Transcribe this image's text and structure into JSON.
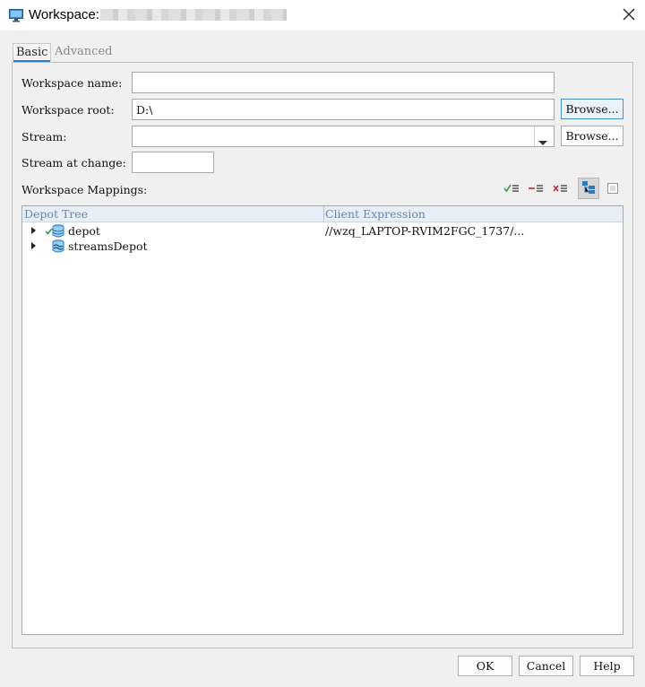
{
  "window": {
    "title": "Workspace:",
    "title_icon": "monitor-icon",
    "close_icon": "close-icon"
  },
  "tabs": [
    {
      "label": "Basic",
      "selected": true
    },
    {
      "label": "Advanced",
      "selected": false
    }
  ],
  "form": {
    "workspace_name": {
      "label": "Workspace name:",
      "value": ""
    },
    "workspace_root": {
      "label": "Workspace root:",
      "value": "D:\\",
      "browse_label": "Browse..."
    },
    "stream": {
      "label": "Stream:",
      "value": "",
      "browse_label": "Browse..."
    },
    "stream_at_change": {
      "label": "Stream at change:",
      "value": ""
    }
  },
  "mappings": {
    "label": "Workspace Mappings:",
    "toolbar": [
      "include-mapping-icon",
      "exclude-mapping-icon",
      "remove-mapping-icon",
      "tree-view-icon",
      "text-view-icon"
    ],
    "columns": [
      "Depot Tree",
      "Client Expression"
    ],
    "rows": [
      {
        "name": "depot",
        "icon": "depot-icon",
        "included": true,
        "expression": "//wzq_LAPTOP-RVIM2FGC_1737/..."
      },
      {
        "name": "streamsDepot",
        "icon": "streams-depot-icon",
        "included": false,
        "expression": ""
      }
    ]
  },
  "footer": {
    "ok": "OK",
    "cancel": "Cancel",
    "help": "Help"
  },
  "colors": {
    "accent": "#2d7fd2",
    "header_bg": "#e7eef6",
    "header_text": "#6a87a8",
    "include_green": "#2a9a3a",
    "exclude_red": "#c62828"
  }
}
